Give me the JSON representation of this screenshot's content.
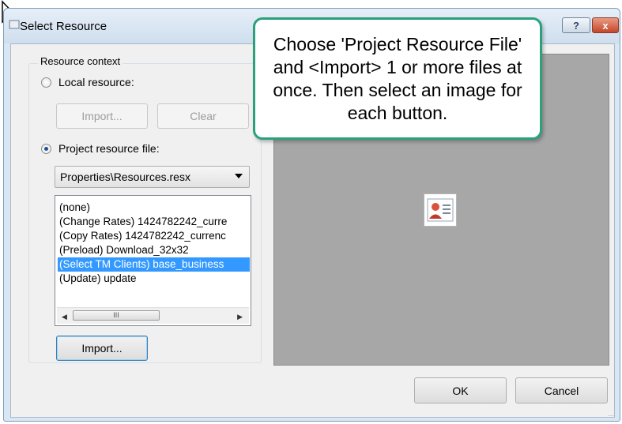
{
  "window": {
    "title": "Select Resource",
    "help_label": "?",
    "close_label": "x"
  },
  "resource_context": {
    "legend": "Resource context",
    "local_resource_label": "Local resource:",
    "local_import_label": "Import...",
    "local_clear_label": "Clear",
    "project_resource_label": "Project resource file:",
    "project_file_selected": "Properties\\Resources.resx",
    "list_items": [
      "(none)",
      "(Change Rates) 1424782242_curre",
      "(Copy Rates) 1424782242_currenc",
      "(Preload) Download_32x32",
      "(Select TM Clients) base_business",
      "(Update) update"
    ],
    "selected_index": 4,
    "scroll_left_icon": "left-arrow-icon",
    "scroll_right_icon": "right-arrow-icon",
    "scroll_thumb_grip": "III",
    "import_label": "Import..."
  },
  "preview": {
    "image_icon": "contact-card-icon"
  },
  "callout": {
    "text": "Choose 'Project Resource File' and <Import> 1 or more files at once.  Then select an image for each button."
  },
  "footer": {
    "ok_label": "OK",
    "cancel_label": "Cancel"
  },
  "colors": {
    "selection": "#3399ff",
    "callout_border": "#2aa07c",
    "preview_bg": "#a7a7a7"
  }
}
